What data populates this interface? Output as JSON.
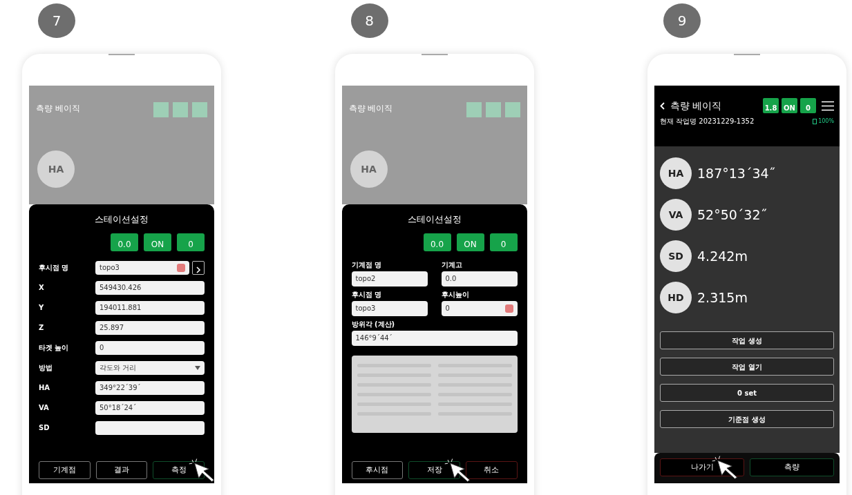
{
  "panels": [
    {
      "step": "7",
      "kind": "station_form",
      "backdrop": {
        "title": "측량 베이직",
        "circle": "HA"
      },
      "sheet": {
        "title": "스테이션설정",
        "badges": [
          {
            "value": "0.0"
          },
          {
            "value": "ON"
          },
          {
            "value": "0"
          }
        ],
        "fields": [
          {
            "label": "후시점 명",
            "value": "topo3",
            "kind": "clearable"
          },
          {
            "label": "X",
            "value": "549430.426",
            "kind": "text"
          },
          {
            "label": "Y",
            "value": "194011.881",
            "kind": "text"
          },
          {
            "label": "Z",
            "value": "25.897",
            "kind": "text"
          },
          {
            "label": "타겟 높이",
            "value": "0",
            "kind": "text"
          },
          {
            "label": "방법",
            "value": "각도와 거리",
            "kind": "select"
          },
          {
            "label": "HA",
            "value": "349°22´39´",
            "kind": "text"
          },
          {
            "label": "VA",
            "value": "50°18´24´",
            "kind": "text"
          },
          {
            "label": "SD",
            "kind": "text"
          }
        ],
        "buttons": [
          {
            "label": "기계점",
            "kind": "plain",
            "clicked": false
          },
          {
            "label": "결과",
            "kind": "plain",
            "clicked": false
          },
          {
            "label": "측정",
            "kind": "confirm",
            "clicked": true
          }
        ]
      }
    },
    {
      "step": "8",
      "kind": "station_grid",
      "backdrop": {
        "title": "측량 베이직",
        "circle": "HA"
      },
      "sheet": {
        "title": "스테이션설정",
        "badges": [
          {
            "value": "0.0"
          },
          {
            "value": "ON"
          },
          {
            "value": "0"
          }
        ],
        "fields": [
          {
            "label": "기계점 명",
            "value": "topo2",
            "kind": "text",
            "wide": false
          },
          {
            "label": "기계고",
            "value": "0.0",
            "kind": "text",
            "wide": false
          },
          {
            "label": "후시점 명",
            "value": "topo3",
            "kind": "text",
            "wide": false
          },
          {
            "label": "후시높이",
            "value": "0",
            "kind": "clearable",
            "wide": false
          },
          {
            "label": "방위각 (계산)",
            "value": "146°9´44´",
            "kind": "text",
            "wide": true
          }
        ],
        "buttons": [
          {
            "label": "후시점",
            "kind": "plain",
            "clicked": false
          },
          {
            "label": "저장",
            "kind": "confirm",
            "clicked": true
          },
          {
            "label": "취소",
            "kind": "cancel",
            "clicked": false
          }
        ]
      }
    },
    {
      "step": "9",
      "kind": "main_screen",
      "header": {
        "title": "측량 베이직",
        "badges": [
          {
            "value": "1.8"
          },
          {
            "value": "ON"
          },
          {
            "value": "0"
          }
        ],
        "job": "현재 작업명 20231229-1352",
        "battery": "100%"
      },
      "readings": [
        {
          "label": "HA",
          "value": "187°13´34˝"
        },
        {
          "label": "VA",
          "value": "52°50´32˝"
        },
        {
          "label": "SD",
          "value": "4.242m"
        },
        {
          "label": "HD",
          "value": "2.315m"
        }
      ],
      "actions": [
        {
          "label": "작업 생성"
        },
        {
          "label": "작업 열기"
        },
        {
          "label": "0 set"
        },
        {
          "label": "기준점 생성"
        }
      ],
      "buttons": [
        {
          "label": "나가기",
          "kind": "cancel",
          "clicked": true
        },
        {
          "label": "측량",
          "kind": "confirm",
          "clicked": false
        }
      ]
    }
  ]
}
